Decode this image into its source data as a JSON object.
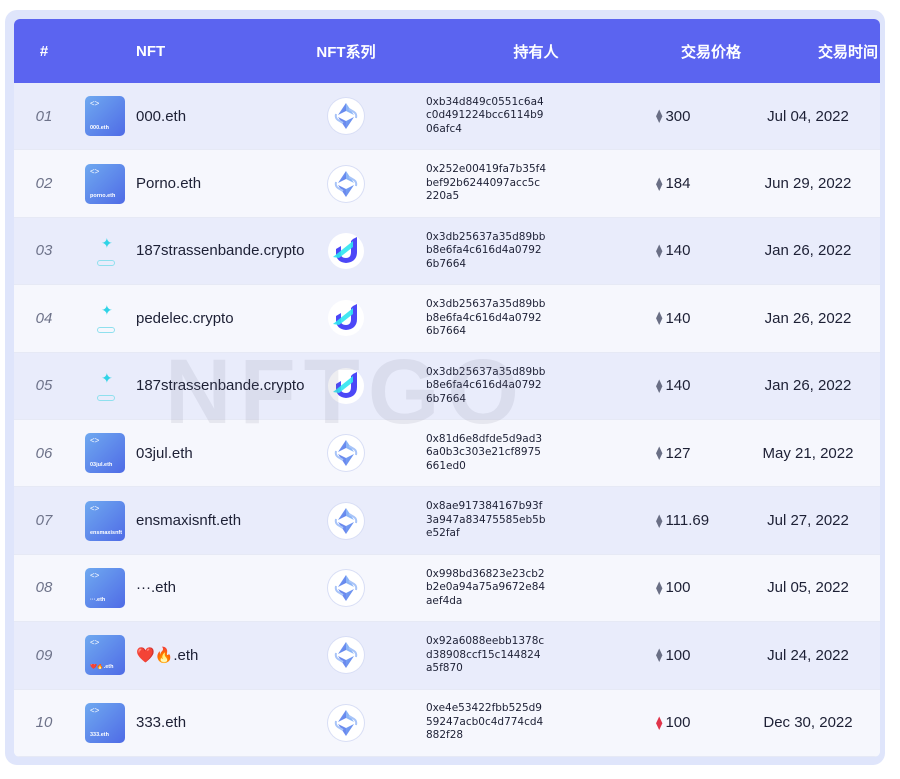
{
  "headers": {
    "rank": "#",
    "nft": "NFT",
    "collection": "NFT系列",
    "owner": "持有人",
    "price": "交易价格",
    "time": "交易时间"
  },
  "watermark": "NFTGO",
  "colors": {
    "header_bg": "#5b64f0",
    "row_odd": "#e9ecfb",
    "row_even": "#f6f7fd",
    "frame": "#dfe5fb"
  },
  "rows": [
    {
      "rank": "01",
      "name": "000.eth",
      "tile_label": "000.eth",
      "collection": "ens-icon",
      "owner": "0xb34d849c0551c6a4c0d491224bcc6114b906afc4",
      "price": "300",
      "time": "Jul 04, 2022"
    },
    {
      "rank": "02",
      "name": "Porno.eth",
      "tile_label": "porno.eth",
      "collection": "ens-icon",
      "owner": "0x252e00419fa7b35f4bef92b6244097acc5c220a5",
      "price": "184",
      "time": "Jun 29, 2022"
    },
    {
      "rank": "03",
      "name": "187strassenbande.crypto",
      "tile_label": "",
      "collection": "ud-icon",
      "owner": "0x3db25637a35d89bbb8e6fa4c616d4a07926b7664",
      "price": "140",
      "time": "Jan 26, 2022"
    },
    {
      "rank": "04",
      "name": "pedelec.crypto",
      "tile_label": "",
      "collection": "ud-icon",
      "owner": "0x3db25637a35d89bbb8e6fa4c616d4a07926b7664",
      "price": "140",
      "time": "Jan 26, 2022"
    },
    {
      "rank": "05",
      "name": "187strassenbande.crypto",
      "tile_label": "",
      "collection": "ud-icon",
      "owner": "0x3db25637a35d89bbb8e6fa4c616d4a07926b7664",
      "price": "140",
      "time": "Jan 26, 2022"
    },
    {
      "rank": "06",
      "name": "03jul.eth",
      "tile_label": "03jul.eth",
      "collection": "ens-icon",
      "owner": "0x81d6e8dfde5d9ad36a0b3c303e21cf8975661ed0",
      "price": "127",
      "time": "May 21, 2022"
    },
    {
      "rank": "07",
      "name": "ensmaxisnft.eth",
      "tile_label": "ensmaxisnft.eth",
      "collection": "ens-icon",
      "owner": "0x8ae917384167b93f3a947a83475585eb5be52faf",
      "price": "111.69",
      "time": "Jul 27, 2022"
    },
    {
      "rank": "08",
      "name": "···.eth",
      "tile_label": "···.eth",
      "collection": "ens-icon",
      "owner": "0x998bd36823e23cb2b2e0a94a75a9672e84aef4da",
      "price": "100",
      "time": "Jul 05, 2022"
    },
    {
      "rank": "09",
      "name": "❤️🔥.eth",
      "tile_label": "❤️🔥.eth",
      "collection": "ens-icon",
      "owner": "0x92a6088eebb1378cd38908ccf15c144824a5f870",
      "price": "100",
      "time": "Jul 24, 2022"
    },
    {
      "rank": "10",
      "name": "333.eth",
      "tile_label": "333.eth",
      "collection": "ens-icon",
      "owner": "0xe4e53422fbb525d959247acb0c4d774cd4882f28",
      "price": "100",
      "time": "Dec 30, 2022",
      "price_red": true
    }
  ]
}
